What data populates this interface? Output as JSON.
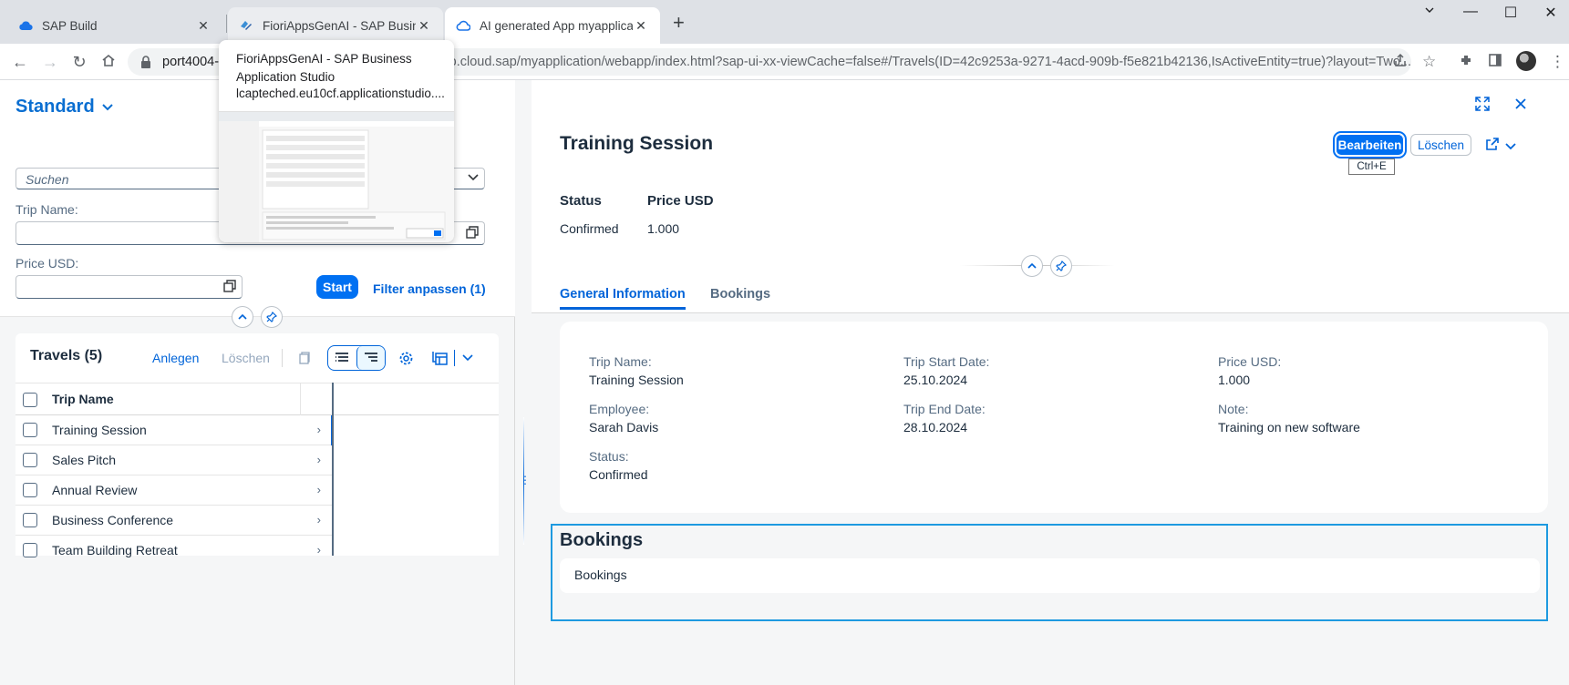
{
  "browser": {
    "tabs": [
      {
        "title": "SAP Build",
        "close": "✕"
      },
      {
        "title": "FioriAppsGenAI - SAP Business A",
        "close": "✕"
      },
      {
        "title": "AI generated App myapplication",
        "close": "✕"
      }
    ],
    "new_tab": "+",
    "window_controls": {
      "minimize": "—",
      "maximize": "☐",
      "close": "✕"
    },
    "url_host": "port4004-w",
    "url_rest": "dio.cloud.sap/myapplication/webapp/index.html?sap-ui-xx-viewCache=false#/Travels(ID=42c9253a-9271-4acd-909b-f5e821b42136,IsActiveEntity=true)?layout=Two...",
    "hovercard": {
      "title": "FioriAppsGenAI - SAP Business Application Studio",
      "host": "lcapteched.eu10cf.applicationstudio...."
    }
  },
  "list_report": {
    "variant": "Standard",
    "search_placeholder": "Suchen",
    "filters": [
      {
        "label": "Trip Name:",
        "value": ""
      },
      {
        "label": "Price USD:",
        "value": ""
      }
    ],
    "go_button": "Start",
    "adapt_filters": "Filter anpassen (1)",
    "table": {
      "title": "Travels (5)",
      "create": "Anlegen",
      "delete": "Löschen",
      "column": "Trip Name",
      "rows": [
        "Training Session",
        "Sales Pitch",
        "Annual Review",
        "Business Conference",
        "Team Building Retreat"
      ]
    }
  },
  "object_page": {
    "title": "Training Session",
    "edit_button": "Bearbeiten",
    "edit_shortcut": "Ctrl+E",
    "delete_button": "Löschen",
    "kpis": [
      {
        "label": "Status",
        "value": "Confirmed"
      },
      {
        "label": "Price USD",
        "value": "1.000"
      }
    ],
    "tabs": [
      "General Information",
      "Bookings"
    ],
    "general_info": {
      "trip_name_label": "Trip Name:",
      "trip_name": "Training Session",
      "employee_label": "Employee:",
      "employee": "Sarah Davis",
      "status_label": "Status:",
      "status": "Confirmed",
      "start_label": "Trip Start Date:",
      "start": "25.10.2024",
      "end_label": "Trip End Date:",
      "end": "28.10.2024",
      "price_label": "Price USD:",
      "price": "1.000",
      "note_label": "Note:",
      "note": "Training on new software"
    },
    "bookings_section": {
      "title": "Bookings",
      "content": "Bookings"
    }
  },
  "colors": {
    "brand": "#0070f2",
    "link": "#0064d9",
    "focus": "#1e9ae0"
  }
}
